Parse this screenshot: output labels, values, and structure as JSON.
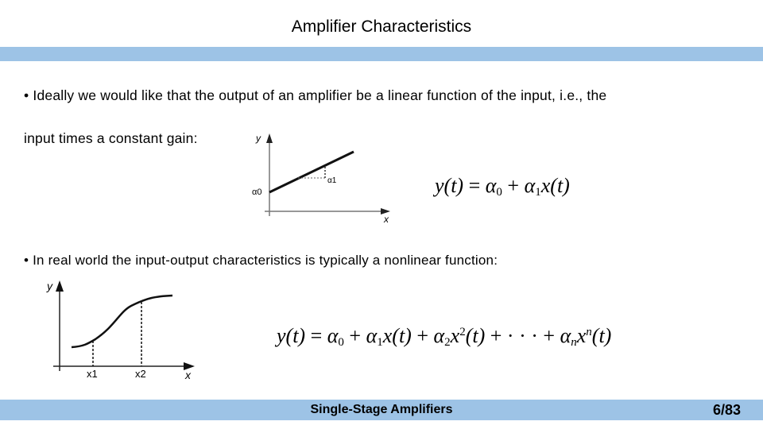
{
  "slide": {
    "title": "Amplifier Characteristics",
    "bullets": [
      {
        "line1": "• Ideally we would like that the output of an amplifier be a linear function of the input, i.e., the",
        "line2": "input times a constant gain:"
      },
      {
        "line1": "• In real world the input-output characteristics is typically a nonlinear function:"
      }
    ],
    "linear_equation": {
      "lhs": "y(t)",
      "eq": "=",
      "a0": "α",
      "a0_sub": "0",
      "plus": "+",
      "a1": "α",
      "a1_sub": "1",
      "rest": "x(t)"
    },
    "nonlinear_equation": {
      "lhs": "y(t)",
      "eq": "=",
      "t0": "α",
      "t0_sub": "0",
      "t1": "α",
      "t1_sub": "1",
      "t1_x": "x(t)",
      "t2": "α",
      "t2_sub": "2",
      "t2_x": "x",
      "t2_sup": "2",
      "t2_t": "(t)",
      "dots": "+ · · · +",
      "tn": "α",
      "tn_sub": "n",
      "tn_x": "x",
      "tn_sup": "n",
      "tn_t": "(t)",
      "plus": "+"
    },
    "linear_plot": {
      "y_label": "y",
      "x_label": "x",
      "intercept_label": "α0",
      "slope_label": "α1"
    },
    "nonlinear_plot": {
      "y_label": "y",
      "x_label": "x",
      "x1_label": "x1",
      "x2_label": "x2"
    },
    "footer": "Single-Stage Amplifiers",
    "page_number": "6/83",
    "colors": {
      "band": "#9dc3e6"
    }
  }
}
